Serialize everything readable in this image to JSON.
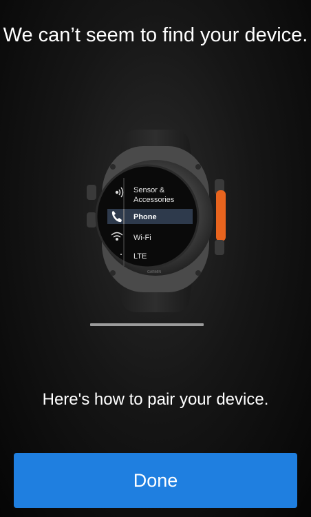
{
  "heading": "We can’t seem to find your device.",
  "subheading": "Here's how to pair your device.",
  "done_button": "Done",
  "watch": {
    "brand": "GARMIN",
    "menu": [
      {
        "label_line1": "Sensor &",
        "label_line2": "Accessories",
        "icon": "sensor-icon"
      },
      {
        "label": "Phone",
        "icon": "phone-icon",
        "selected": true
      },
      {
        "label": "Wi-Fi",
        "icon": "wifi-icon"
      },
      {
        "label": "LTE",
        "icon": "lte-icon"
      }
    ],
    "accent_color": "#e8641e"
  },
  "pager": {
    "current": 1,
    "total": 1
  },
  "colors": {
    "button": "#1f7fe0",
    "background": "#000000",
    "text": "#ffffff"
  }
}
